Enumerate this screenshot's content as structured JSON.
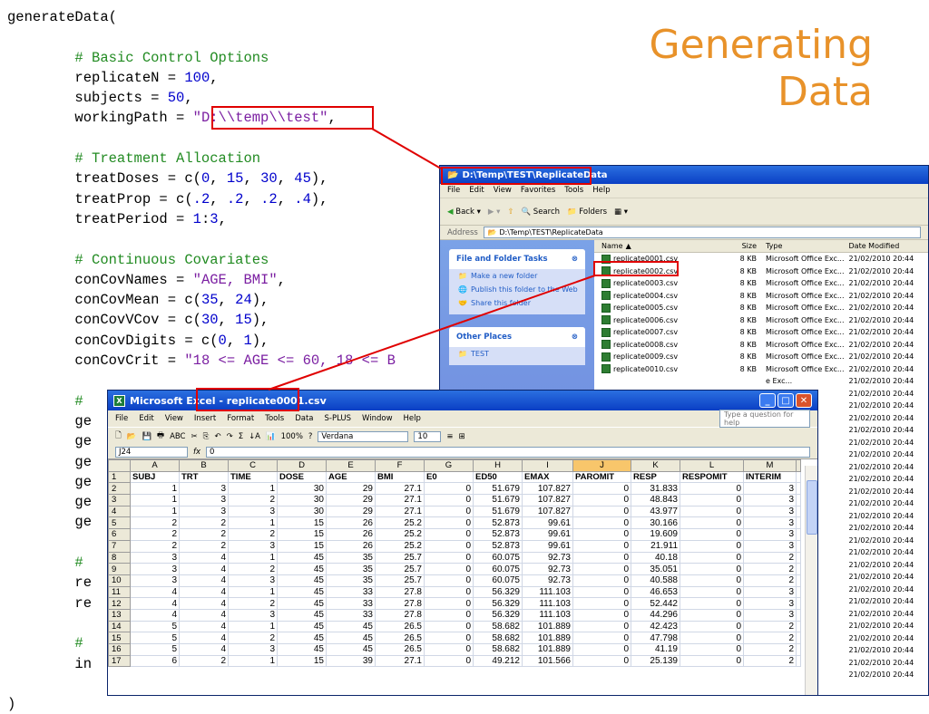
{
  "slide_title": [
    "Generating",
    "Data"
  ],
  "code_lines": [
    [
      {
        "t": "generateData("
      }
    ],
    [
      {
        "t": ""
      }
    ],
    [
      {
        "t": "        # Basic Control Options",
        "k": "c"
      }
    ],
    [
      {
        "t": "        replicateN = "
      },
      {
        "t": "100",
        "k": "n"
      },
      {
        "t": ","
      }
    ],
    [
      {
        "t": "        subjects = "
      },
      {
        "t": "50",
        "k": "n"
      },
      {
        "t": ","
      }
    ],
    [
      {
        "t": "        workingPath = "
      },
      {
        "t": "\"D:\\\\temp\\\\test\"",
        "k": "s"
      },
      {
        "t": ","
      }
    ],
    [
      {
        "t": ""
      }
    ],
    [
      {
        "t": "        # Treatment Allocation",
        "k": "c"
      }
    ],
    [
      {
        "t": "        treatDoses = c("
      },
      {
        "t": "0",
        "k": "n"
      },
      {
        "t": ", "
      },
      {
        "t": "15",
        "k": "n"
      },
      {
        "t": ", "
      },
      {
        "t": "30",
        "k": "n"
      },
      {
        "t": ", "
      },
      {
        "t": "45",
        "k": "n"
      },
      {
        "t": "),"
      }
    ],
    [
      {
        "t": "        treatProp = c("
      },
      {
        "t": ".2",
        "k": "n"
      },
      {
        "t": ", "
      },
      {
        "t": ".2",
        "k": "n"
      },
      {
        "t": ", "
      },
      {
        "t": ".2",
        "k": "n"
      },
      {
        "t": ", "
      },
      {
        "t": ".4",
        "k": "n"
      },
      {
        "t": "),"
      }
    ],
    [
      {
        "t": "        treatPeriod = "
      },
      {
        "t": "1",
        "k": "n"
      },
      {
        "t": ":"
      },
      {
        "t": "3",
        "k": "n"
      },
      {
        "t": ","
      }
    ],
    [
      {
        "t": ""
      }
    ],
    [
      {
        "t": "        # Continuous Covariates",
        "k": "c"
      }
    ],
    [
      {
        "t": "        conCovNames = "
      },
      {
        "t": "\"AGE, BMI\"",
        "k": "s"
      },
      {
        "t": ","
      }
    ],
    [
      {
        "t": "        conCovMean = c("
      },
      {
        "t": "35",
        "k": "n"
      },
      {
        "t": ", "
      },
      {
        "t": "24",
        "k": "n"
      },
      {
        "t": "),"
      }
    ],
    [
      {
        "t": "        conCovVCov = c("
      },
      {
        "t": "30",
        "k": "n"
      },
      {
        "t": ", "
      },
      {
        "t": "15",
        "k": "n"
      },
      {
        "t": "),"
      }
    ],
    [
      {
        "t": "        conCovDigits = c("
      },
      {
        "t": "0",
        "k": "n"
      },
      {
        "t": ", "
      },
      {
        "t": "1",
        "k": "n"
      },
      {
        "t": "),"
      }
    ],
    [
      {
        "t": "        conCovCrit = "
      },
      {
        "t": "\"18 <= AGE <= 60, 18 <= B",
        "k": "s"
      }
    ],
    [
      {
        "t": ""
      }
    ],
    [
      {
        "t": "        #",
        "k": "c"
      }
    ],
    [
      {
        "t": "        ge"
      }
    ],
    [
      {
        "t": "        ge"
      }
    ],
    [
      {
        "t": "        ge"
      }
    ],
    [
      {
        "t": "        ge"
      }
    ],
    [
      {
        "t": "        ge"
      }
    ],
    [
      {
        "t": "        ge"
      }
    ],
    [
      {
        "t": ""
      }
    ],
    [
      {
        "t": "        #",
        "k": "c"
      }
    ],
    [
      {
        "t": "        re"
      }
    ],
    [
      {
        "t": "        re"
      }
    ],
    [
      {
        "t": ""
      }
    ],
    [
      {
        "t": "        #",
        "k": "c"
      }
    ],
    [
      {
        "t": "        in"
      }
    ],
    [
      {
        "t": ""
      }
    ],
    [
      {
        "t": ")"
      }
    ]
  ],
  "explorer": {
    "title": "D:\\Temp\\TEST\\ReplicateData",
    "menu": [
      "File",
      "Edit",
      "View",
      "Favorites",
      "Tools",
      "Help"
    ],
    "toolbar": {
      "back": "Back",
      "search": "Search",
      "folders": "Folders"
    },
    "address_label": "Address",
    "address": "D:\\Temp\\TEST\\ReplicateData",
    "tasks_title": "File and Folder Tasks",
    "tasks": [
      "Make a new folder",
      "Publish this folder to the Web",
      "Share this folder"
    ],
    "places_title": "Other Places",
    "places": [
      "TEST"
    ],
    "columns": [
      "Name",
      "Size",
      "Type",
      "Date Modified"
    ],
    "files": [
      {
        "name": "replicate0001.csv",
        "size": "8 KB",
        "type": "Microsoft Office Exc...",
        "date": "21/02/2010 20:44"
      },
      {
        "name": "replicate0002.csv",
        "size": "8 KB",
        "type": "Microsoft Office Exc...",
        "date": "21/02/2010 20:44"
      },
      {
        "name": "replicate0003.csv",
        "size": "8 KB",
        "type": "Microsoft Office Exc...",
        "date": "21/02/2010 20:44"
      },
      {
        "name": "replicate0004.csv",
        "size": "8 KB",
        "type": "Microsoft Office Exc...",
        "date": "21/02/2010 20:44"
      },
      {
        "name": "replicate0005.csv",
        "size": "8 KB",
        "type": "Microsoft Office Exc...",
        "date": "21/02/2010 20:44"
      },
      {
        "name": "replicate0006.csv",
        "size": "8 KB",
        "type": "Microsoft Office Exc...",
        "date": "21/02/2010 20:44"
      },
      {
        "name": "replicate0007.csv",
        "size": "8 KB",
        "type": "Microsoft Office Exc...",
        "date": "21/02/2010 20:44"
      },
      {
        "name": "replicate0008.csv",
        "size": "8 KB",
        "type": "Microsoft Office Exc...",
        "date": "21/02/2010 20:44"
      },
      {
        "name": "replicate0009.csv",
        "size": "8 KB",
        "type": "Microsoft Office Exc...",
        "date": "21/02/2010 20:44"
      },
      {
        "name": "replicate0010.csv",
        "size": "8 KB",
        "type": "Microsoft Office Exc...",
        "date": "21/02/2010 20:44"
      },
      {
        "name": "",
        "size": "",
        "type": "e Exc...",
        "date": "21/02/2010 20:44"
      },
      {
        "name": "",
        "size": "",
        "type": "e Exc...",
        "date": "21/02/2010 20:44"
      },
      {
        "name": "",
        "size": "",
        "type": "e Exc...",
        "date": "21/02/2010 20:44"
      },
      {
        "name": "",
        "size": "",
        "type": "e Exc...",
        "date": "21/02/2010 20:44"
      },
      {
        "name": "",
        "size": "",
        "type": "e Exc...",
        "date": "21/02/2010 20:44"
      },
      {
        "name": "",
        "size": "",
        "type": "e Exc...",
        "date": "21/02/2010 20:44"
      },
      {
        "name": "",
        "size": "",
        "type": "e Exc...",
        "date": "21/02/2010 20:44"
      },
      {
        "name": "",
        "size": "",
        "type": "e Exc...",
        "date": "21/02/2010 20:44"
      },
      {
        "name": "",
        "size": "",
        "type": "e Exc...",
        "date": "21/02/2010 20:44"
      },
      {
        "name": "",
        "size": "",
        "type": "e Exc...",
        "date": "21/02/2010 20:44"
      },
      {
        "name": "",
        "size": "",
        "type": "e Exc...",
        "date": "21/02/2010 20:44"
      },
      {
        "name": "",
        "size": "",
        "type": "e Exc...",
        "date": "21/02/2010 20:44"
      },
      {
        "name": "",
        "size": "",
        "type": "e Exc...",
        "date": "21/02/2010 20:44"
      },
      {
        "name": "",
        "size": "",
        "type": "e Exc...",
        "date": "21/02/2010 20:44"
      },
      {
        "name": "",
        "size": "",
        "type": "e Exc...",
        "date": "21/02/2010 20:44"
      },
      {
        "name": "",
        "size": "",
        "type": "e Exc...",
        "date": "21/02/2010 20:44"
      },
      {
        "name": "",
        "size": "",
        "type": "e Exc...",
        "date": "21/02/2010 20:44"
      },
      {
        "name": "",
        "size": "",
        "type": "e Exc...",
        "date": "21/02/2010 20:44"
      },
      {
        "name": "",
        "size": "",
        "type": "e Exc...",
        "date": "21/02/2010 20:44"
      },
      {
        "name": "",
        "size": "",
        "type": "e Exc...",
        "date": "21/02/2010 20:44"
      },
      {
        "name": "",
        "size": "",
        "type": "e Exc...",
        "date": "21/02/2010 20:44"
      },
      {
        "name": "",
        "size": "",
        "type": "e Exc...",
        "date": "21/02/2010 20:44"
      },
      {
        "name": "",
        "size": "",
        "type": "e Exc...",
        "date": "21/02/2010 20:44"
      },
      {
        "name": "",
        "size": "",
        "type": "e Exc...",
        "date": "21/02/2010 20:44"
      },
      {
        "name": "",
        "size": "",
        "type": "e Exc...",
        "date": "21/02/2010 20:44"
      }
    ]
  },
  "excel": {
    "title": "Microsoft Excel - replicate0001.csv",
    "menu": [
      "File",
      "Edit",
      "View",
      "Insert",
      "Format",
      "Tools",
      "Data",
      "S-PLUS",
      "Window",
      "Help"
    ],
    "help_placeholder": "Type a question for help",
    "zoom": "100%",
    "font": "Verdana",
    "font_size": "10",
    "name_box": "J24",
    "formula": "0",
    "columns": [
      "A",
      "B",
      "C",
      "D",
      "E",
      "F",
      "G",
      "H",
      "I",
      "J",
      "K",
      "L",
      "M"
    ],
    "headers": [
      "SUBJ",
      "TRT",
      "TIME",
      "DOSE",
      "AGE",
      "BMI",
      "E0",
      "ED50",
      "EMAX",
      "PAROMIT",
      "RESP",
      "RESPOMIT",
      "INTERIM"
    ],
    "rows": [
      [
        "1",
        "3",
        "1",
        "30",
        "29",
        "27.1",
        "0",
        "51.679",
        "107.827",
        "0",
        "31.833",
        "0",
        "3"
      ],
      [
        "1",
        "3",
        "2",
        "30",
        "29",
        "27.1",
        "0",
        "51.679",
        "107.827",
        "0",
        "48.843",
        "0",
        "3"
      ],
      [
        "1",
        "3",
        "3",
        "30",
        "29",
        "27.1",
        "0",
        "51.679",
        "107.827",
        "0",
        "43.977",
        "0",
        "3"
      ],
      [
        "2",
        "2",
        "1",
        "15",
        "26",
        "25.2",
        "0",
        "52.873",
        "99.61",
        "0",
        "30.166",
        "0",
        "3"
      ],
      [
        "2",
        "2",
        "2",
        "15",
        "26",
        "25.2",
        "0",
        "52.873",
        "99.61",
        "0",
        "19.609",
        "0",
        "3"
      ],
      [
        "2",
        "2",
        "3",
        "15",
        "26",
        "25.2",
        "0",
        "52.873",
        "99.61",
        "0",
        "21.911",
        "0",
        "3"
      ],
      [
        "3",
        "4",
        "1",
        "45",
        "35",
        "25.7",
        "0",
        "60.075",
        "92.73",
        "0",
        "40.18",
        "0",
        "2"
      ],
      [
        "3",
        "4",
        "2",
        "45",
        "35",
        "25.7",
        "0",
        "60.075",
        "92.73",
        "0",
        "35.051",
        "0",
        "2"
      ],
      [
        "3",
        "4",
        "3",
        "45",
        "35",
        "25.7",
        "0",
        "60.075",
        "92.73",
        "0",
        "40.588",
        "0",
        "2"
      ],
      [
        "4",
        "4",
        "1",
        "45",
        "33",
        "27.8",
        "0",
        "56.329",
        "111.103",
        "0",
        "46.653",
        "0",
        "3"
      ],
      [
        "4",
        "4",
        "2",
        "45",
        "33",
        "27.8",
        "0",
        "56.329",
        "111.103",
        "0",
        "52.442",
        "0",
        "3"
      ],
      [
        "4",
        "4",
        "3",
        "45",
        "33",
        "27.8",
        "0",
        "56.329",
        "111.103",
        "0",
        "44.296",
        "0",
        "3"
      ],
      [
        "5",
        "4",
        "1",
        "45",
        "45",
        "26.5",
        "0",
        "58.682",
        "101.889",
        "0",
        "42.423",
        "0",
        "2"
      ],
      [
        "5",
        "4",
        "2",
        "45",
        "45",
        "26.5",
        "0",
        "58.682",
        "101.889",
        "0",
        "47.798",
        "0",
        "2"
      ],
      [
        "5",
        "4",
        "3",
        "45",
        "45",
        "26.5",
        "0",
        "58.682",
        "101.889",
        "0",
        "41.19",
        "0",
        "2"
      ],
      [
        "6",
        "2",
        "1",
        "15",
        "39",
        "27.1",
        "0",
        "49.212",
        "101.566",
        "0",
        "25.139",
        "0",
        "2"
      ]
    ]
  }
}
